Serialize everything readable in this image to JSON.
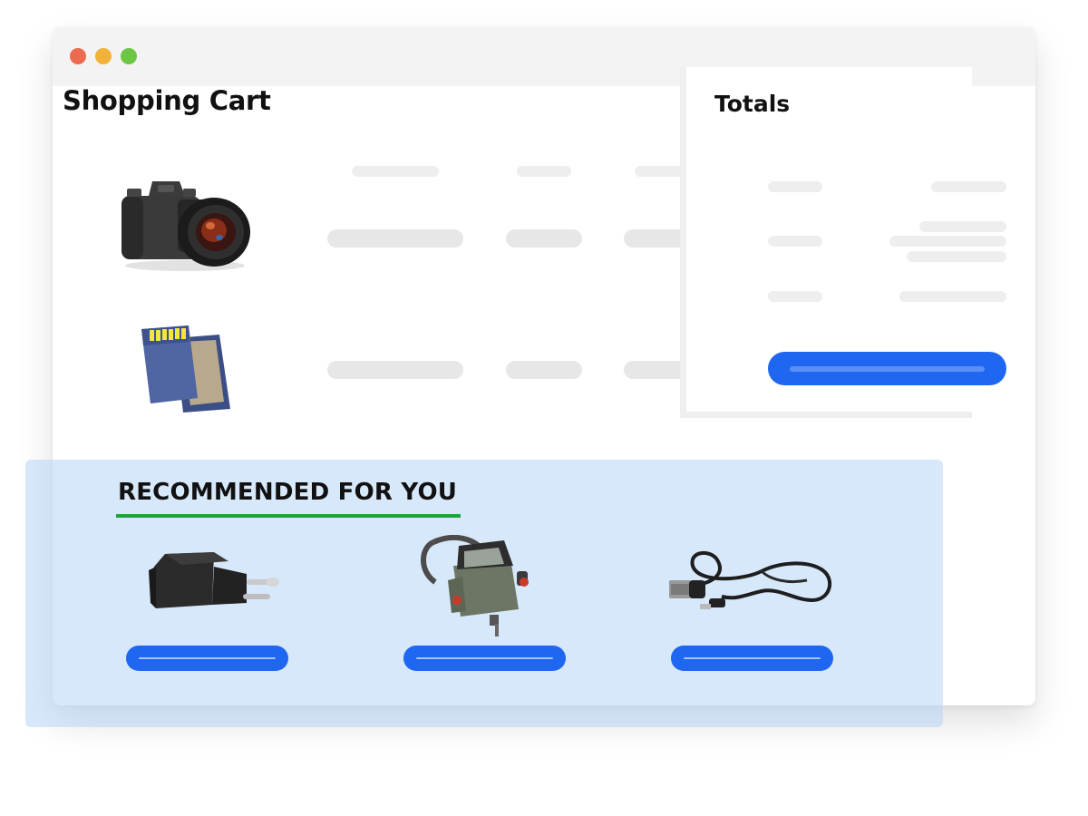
{
  "cart": {
    "title": "Shopping Cart"
  },
  "totals": {
    "title": "Totals"
  },
  "recommended": {
    "title": "RECOMMENDED FOR YOU"
  },
  "icons": {
    "camera": "camera-product-icon",
    "sd_card": "sd-card-product-icon",
    "charger": "charger-product-icon",
    "camera_bag": "camera-bag-product-icon",
    "usb_cable": "usb-cable-product-icon"
  },
  "colors": {
    "accent_blue": "#1f66f0",
    "recommend_bg": "#d6e6f8",
    "underline_green": "#1ca63a",
    "placeholder_gray": "#e7e7e7"
  }
}
